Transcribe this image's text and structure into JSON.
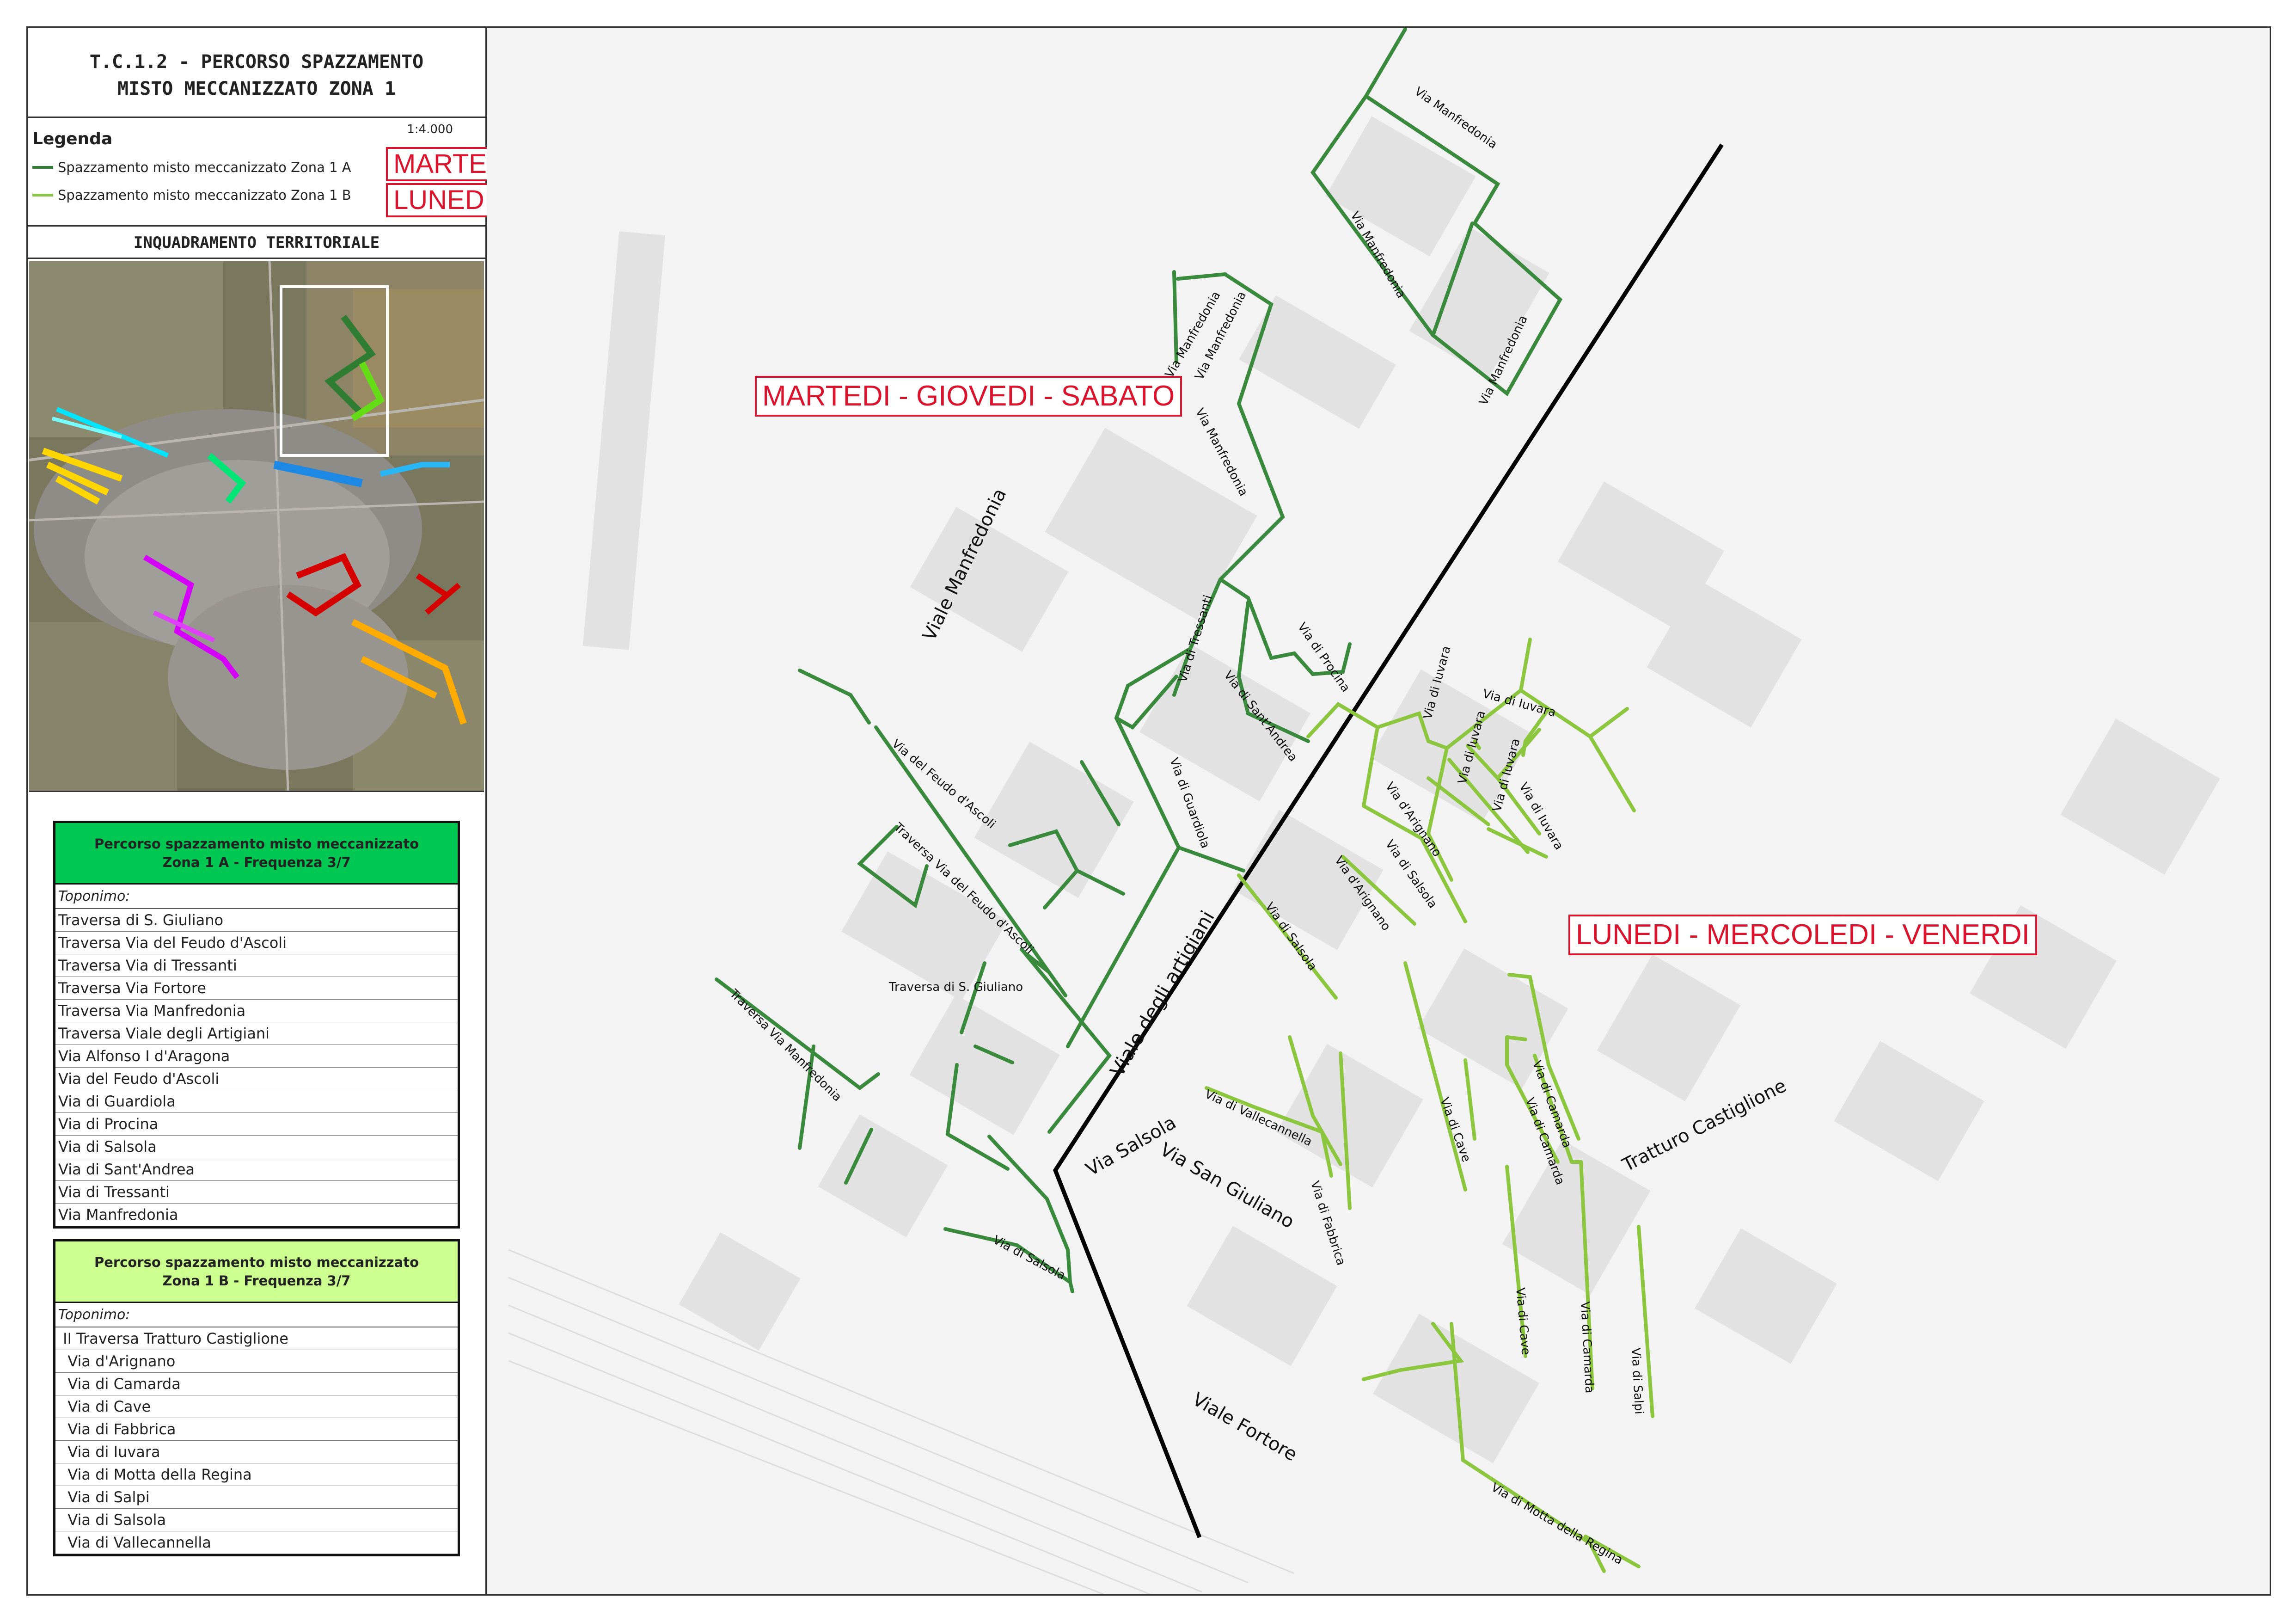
{
  "title": {
    "line1": "T.C.1.2 - PERCORSO SPAZZAMENTO",
    "line2": "MISTO MECCANIZZATO ZONA 1"
  },
  "legend": {
    "heading": "Legenda",
    "scale": "1:4.000",
    "items": [
      {
        "label": "Spazzamento misto meccanizzato Zona 1 A",
        "color": "#2e7d32",
        "schedule": "MARTEDI - GIOVEDI - SABATO"
      },
      {
        "label": "Spazzamento misto meccanizzato Zona 1 B",
        "color": "#8bc34a",
        "schedule": "LUNEDI - MERCOLEDI - VENERDI"
      }
    ]
  },
  "inquadramento": {
    "heading": "INQUADRAMENTO TERRITORIALE"
  },
  "zone_a": {
    "heading_line1": "Percorso spazzamento misto meccanizzato",
    "heading_line2": "Zona 1 A - Frequenza 3/7",
    "header_color": "#00c853",
    "toponimo_label": "Toponimo:",
    "streets": [
      "Traversa di S. Giuliano",
      "Traversa Via del Feudo d'Ascoli",
      "Traversa Via di Tressanti",
      "Traversa Via Fortore",
      "Traversa Via Manfredonia",
      "Traversa Viale degli Artigiani",
      "Via Alfonso I d'Aragona",
      "Via del Feudo d'Ascoli",
      "Via di Guardiola",
      "Via di Procina",
      "Via di Salsola",
      "Via di Sant'Andrea",
      "Via di Tressanti",
      "Via Manfredonia"
    ]
  },
  "zone_b": {
    "heading_line1": "Percorso spazzamento misto meccanizzato",
    "heading_line2": "Zona 1 B - Frequenza 3/7",
    "header_color": "#ccff90",
    "toponimo_label": "Toponimo:",
    "streets": [
      " II Traversa Tratturo Castiglione",
      "  Via d'Arignano",
      "  Via di Camarda",
      "  Via di Cave",
      "  Via di Fabbrica",
      "  Via di Iuvara",
      "  Via di Motta della Regina",
      "  Via di Salpi",
      "  Via di Salsola",
      "  Via di Vallecannella"
    ]
  },
  "callouts": {
    "a": "MARTEDI - GIOVEDI - SABATO",
    "b": "LUNEDI - MERCOLEDI - VENERDI"
  },
  "map_labels": {
    "viale_manfredonia": "Viale Manfredonia",
    "viale_artigiani": "Viale degli artigiani",
    "via_salsola": "Via Salsola",
    "via_san_giuliano": "Via San Giuliano",
    "viale_fortore": "Viale Fortore",
    "tratturo": "Tratturo Castiglione",
    "via_manfredonia": "Via Manfredonia",
    "via_tressanti": "Via di Tressanti",
    "via_procina": "Via di Procina",
    "via_santandrea": "Via di Sant'Andrea",
    "via_guardiola": "Via di Guardiola",
    "via_feudo": "Via del Feudo d'Ascoli",
    "trav_feudo": "Traversa Via del Feudo d'Ascoli",
    "trav_sgiuliano": "Traversa di S. Giuliano",
    "trav_manfredonia": "Traversa Via Manfredonia",
    "via_di_salsola": "Via di Salsola",
    "via_iuvara": "Via di Iuvara",
    "via_arignano": "Via d'Arignano",
    "via_vallecannella": "Via di Vallecannella",
    "via_fabbrica": "Via di Fabbrica",
    "via_cave": "Via di Cave",
    "via_camarda": "Via di Camarda",
    "via_salpi": "Via di Salpi",
    "via_motta": "Via di Motta della Regina"
  }
}
